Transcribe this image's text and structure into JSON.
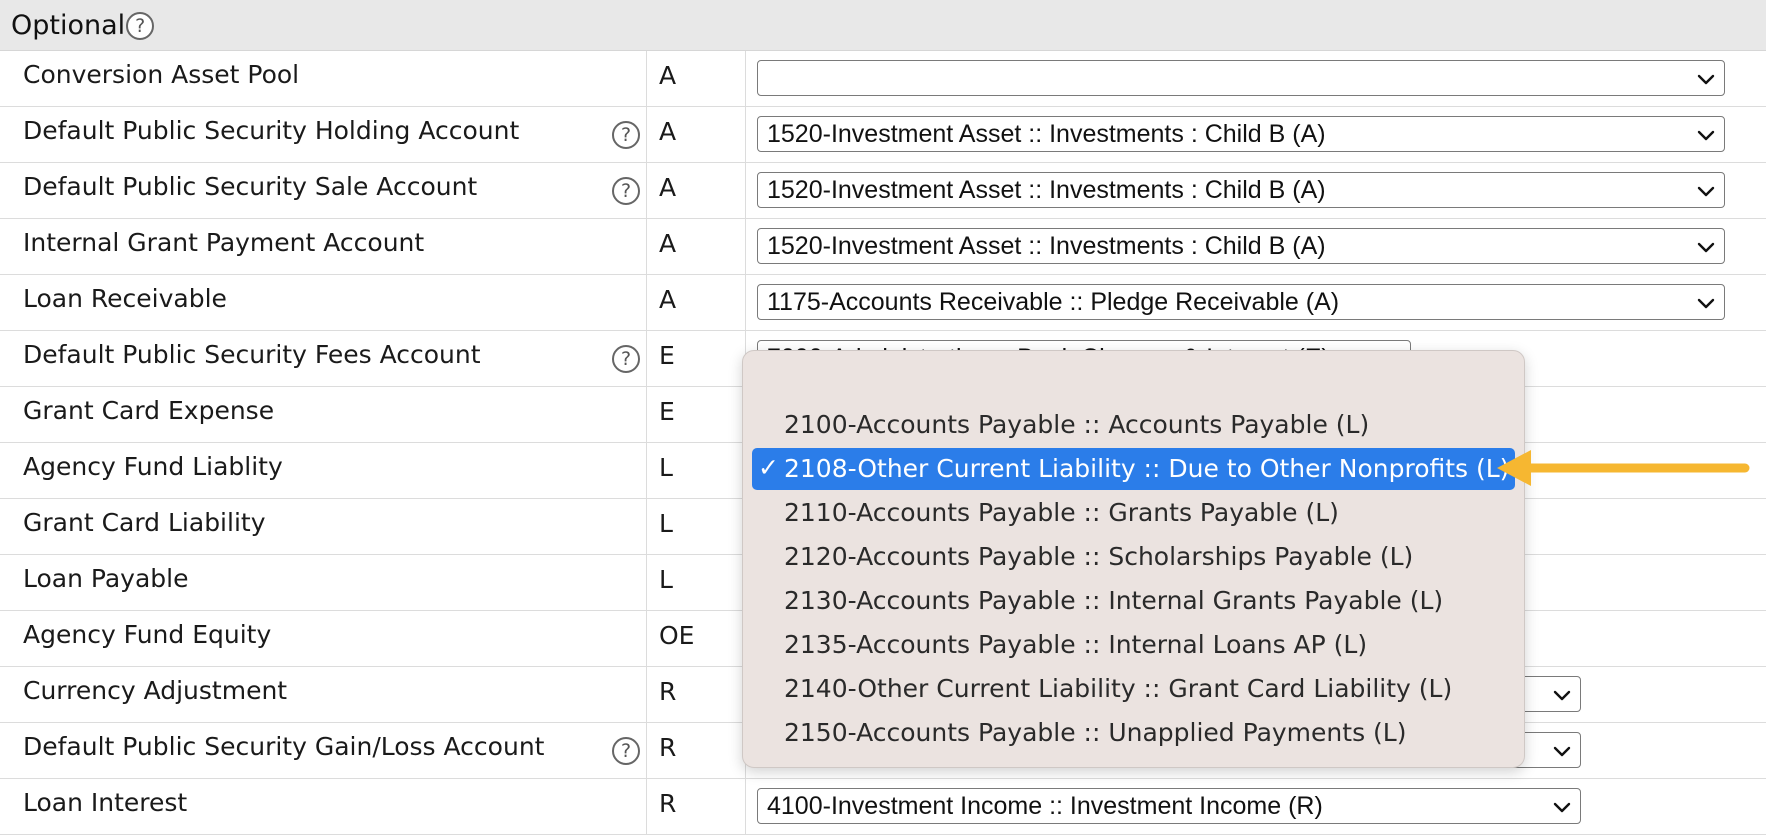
{
  "section": {
    "title": "Optional",
    "help_icon": "question-circle-icon"
  },
  "rows": [
    {
      "label": "Conversion Asset Pool",
      "help": false,
      "type": "A",
      "value": ""
    },
    {
      "label": "Default Public Security Holding Account",
      "help": true,
      "type": "A",
      "value": "1520-Investment Asset :: Investments : Child B (A)"
    },
    {
      "label": "Default Public Security Sale Account",
      "help": true,
      "type": "A",
      "value": "1520-Investment Asset :: Investments : Child B (A)"
    },
    {
      "label": "Internal Grant Payment Account",
      "help": false,
      "type": "A",
      "value": "1520-Investment Asset :: Investments : Child B (A)"
    },
    {
      "label": "Loan Receivable",
      "help": false,
      "type": "A",
      "value": "1175-Accounts Receivable :: Pledge Receivable (A)"
    },
    {
      "label": "Default Public Security Fees Account",
      "help": true,
      "type": "E",
      "value": "7000-Administration :: Bank Charges & Interest (E)"
    },
    {
      "label": "Grant Card Expense",
      "help": false,
      "type": "E",
      "value": ""
    },
    {
      "label": "Agency Fund Liablity",
      "help": false,
      "type": "L",
      "value": ""
    },
    {
      "label": "Grant Card Liability",
      "help": false,
      "type": "L",
      "value": ""
    },
    {
      "label": "Loan Payable",
      "help": false,
      "type": "L",
      "value": ""
    },
    {
      "label": "Agency Fund Equity",
      "help": false,
      "type": "OE",
      "value": ""
    },
    {
      "label": "Currency Adjustment",
      "help": false,
      "type": "R",
      "value": ""
    },
    {
      "label": "Default Public Security Gain/Loss Account",
      "help": true,
      "type": "R",
      "value": ""
    },
    {
      "label": "Loan Interest",
      "help": false,
      "type": "R",
      "value": "4100-Investment Income :: Investment Income (R)"
    }
  ],
  "dropdown": {
    "selected_index": 1,
    "check_glyph": "✓",
    "options": [
      "2100-Accounts Payable :: Accounts Payable (L)",
      "2108-Other Current Liability :: Due to Other Nonprofits (L)",
      "2110-Accounts Payable :: Grants Payable (L)",
      "2120-Accounts Payable :: Scholarships Payable (L)",
      "2130-Accounts Payable :: Internal Grants Payable (L)",
      "2135-Accounts Payable :: Internal Loans AP (L)",
      "2140-Other Current Liability :: Grant Card Liability (L)",
      "2150-Accounts Payable :: Unapplied Payments (L)"
    ]
  },
  "colors": {
    "selection": "#2b7de9",
    "annotation_arrow": "#f6b731",
    "dropdown_bg": "#ebe3e0"
  }
}
